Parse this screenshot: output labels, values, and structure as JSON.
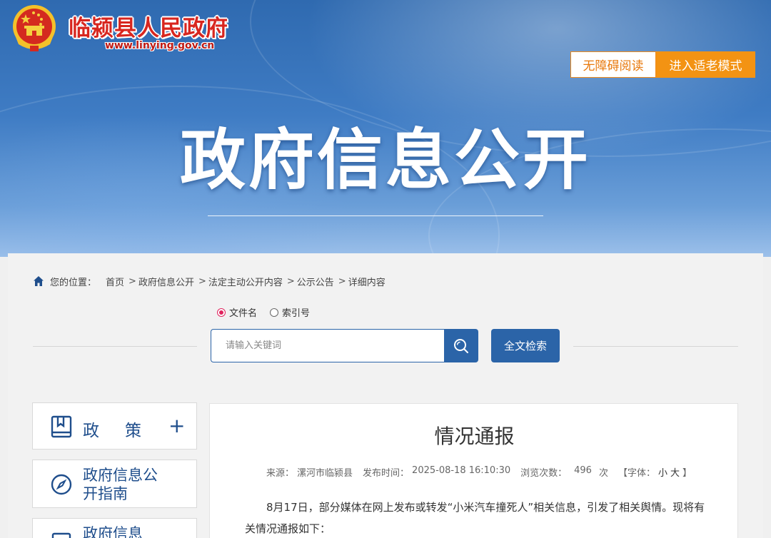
{
  "header": {
    "site_name": "临颍县人民政府",
    "site_url": "www.linying.gov.cn",
    "accessibility_button": "无障碍阅读",
    "elder_mode_button": "进入适老模式",
    "banner_title": "政府信息公开"
  },
  "breadcrumb": {
    "prefix": "您的位置：",
    "items": [
      "首页",
      "政府信息公开",
      "法定主动公开内容",
      "公示公告",
      "详细内容"
    ],
    "separator": ">"
  },
  "search": {
    "radio_options": [
      {
        "label": "文件名",
        "selected": true
      },
      {
        "label": "索引号",
        "selected": false
      }
    ],
    "placeholder": "请输入关键词",
    "fulltext_button": "全文检索"
  },
  "sidebar": {
    "items": [
      {
        "label": "政策",
        "icon": "book-icon",
        "expand": "+"
      },
      {
        "label": "政府信息公开指南",
        "icon": "compass-icon"
      },
      {
        "label": "政府信息",
        "icon": "document-icon"
      }
    ]
  },
  "article": {
    "title": "情况通报",
    "source_label": "来源：",
    "source": "漯河市临颍县",
    "time_label": "发布时间：",
    "time": "2025-08-18 16:10:30",
    "views_label": "浏览次数：",
    "views": "496",
    "views_unit": "次",
    "font_label": "【字体：",
    "font_small": "小",
    "font_large": "大",
    "font_close": "】",
    "body": "8月17日，部分媒体在网上发布或转发“小米汽车撞死人”相关信息，引发了相关舆情。现将有关情况通报如下："
  },
  "colors": {
    "primary_blue": "#2b64a8",
    "elder_orange": "#f39313",
    "site_red": "#d8261f"
  }
}
